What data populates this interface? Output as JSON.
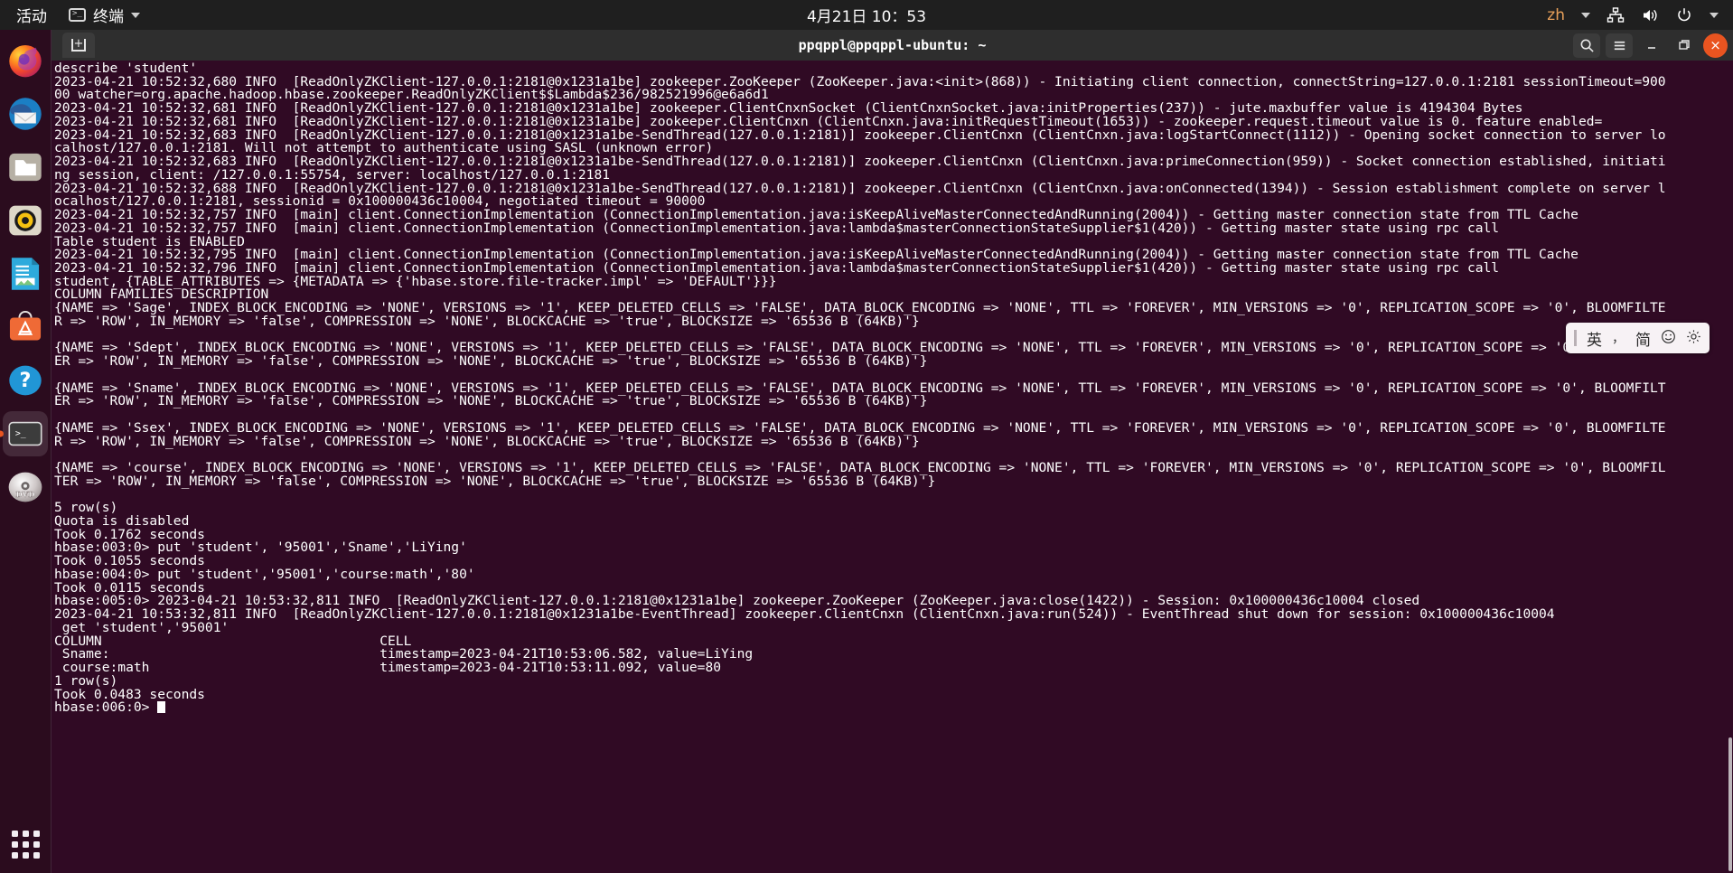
{
  "topbar": {
    "activities": "活动",
    "app_name": "终端",
    "clock": "4月21日 10：53",
    "language": "zh",
    "icons": [
      "network-icon",
      "volume-icon",
      "power-icon",
      "chevron-down-icon"
    ]
  },
  "dock": {
    "items": [
      {
        "name": "firefox",
        "active": false
      },
      {
        "name": "thunderbird",
        "active": false
      },
      {
        "name": "files",
        "active": false
      },
      {
        "name": "rhythmbox",
        "active": false
      },
      {
        "name": "libreoffice-writer",
        "active": false
      },
      {
        "name": "ubuntu-software",
        "active": false
      },
      {
        "name": "help",
        "active": false
      },
      {
        "name": "terminal",
        "active": true
      },
      {
        "name": "dvd-drive",
        "active": false
      }
    ],
    "show_applications_label": "Show Applications"
  },
  "window": {
    "title": "ppqppl@ppqppl-ubuntu: ~",
    "new_tab_label": "+",
    "search_label": "Search",
    "menu_label": "Menu",
    "minimize_label": "Minimize",
    "maximize_label": "Maximize",
    "close_label": "×"
  },
  "ime": {
    "mode": "英",
    "punctuation": "，",
    "script": "简",
    "emoji_label": "☺",
    "settings_label": "settings-icon"
  },
  "terminal": {
    "lines": [
      "describe 'student'",
      "2023-04-21 10:52:32,680 INFO  [ReadOnlyZKClient-127.0.0.1:2181@0x1231a1be] zookeeper.ZooKeeper (ZooKeeper.java:<init>(868)) - Initiating client connection, connectString=127.0.0.1:2181 sessionTimeout=900",
      "00 watcher=org.apache.hadoop.hbase.zookeeper.ReadOnlyZKClient$$Lambda$236/982521996@e6a6d1",
      "2023-04-21 10:52:32,681 INFO  [ReadOnlyZKClient-127.0.0.1:2181@0x1231a1be] zookeeper.ClientCnxnSocket (ClientCnxnSocket.java:initProperties(237)) - jute.maxbuffer value is 4194304 Bytes",
      "2023-04-21 10:52:32,681 INFO  [ReadOnlyZKClient-127.0.0.1:2181@0x1231a1be] zookeeper.ClientCnxn (ClientCnxn.java:initRequestTimeout(1653)) - zookeeper.request.timeout value is 0. feature enabled=",
      "2023-04-21 10:52:32,683 INFO  [ReadOnlyZKClient-127.0.0.1:2181@0x1231a1be-SendThread(127.0.0.1:2181)] zookeeper.ClientCnxn (ClientCnxn.java:logStartConnect(1112)) - Opening socket connection to server lo",
      "calhost/127.0.0.1:2181. Will not attempt to authenticate using SASL (unknown error)",
      "2023-04-21 10:52:32,683 INFO  [ReadOnlyZKClient-127.0.0.1:2181@0x1231a1be-SendThread(127.0.0.1:2181)] zookeeper.ClientCnxn (ClientCnxn.java:primeConnection(959)) - Socket connection established, initiati",
      "ng session, client: /127.0.0.1:55754, server: localhost/127.0.0.1:2181",
      "2023-04-21 10:52:32,688 INFO  [ReadOnlyZKClient-127.0.0.1:2181@0x1231a1be-SendThread(127.0.0.1:2181)] zookeeper.ClientCnxn (ClientCnxn.java:onConnected(1394)) - Session establishment complete on server l",
      "ocalhost/127.0.0.1:2181, sessionid = 0x100000436c10004, negotiated timeout = 90000",
      "2023-04-21 10:52:32,757 INFO  [main] client.ConnectionImplementation (ConnectionImplementation.java:isKeepAliveMasterConnectedAndRunning(2004)) - Getting master connection state from TTL Cache",
      "2023-04-21 10:52:32,757 INFO  [main] client.ConnectionImplementation (ConnectionImplementation.java:lambda$masterConnectionStateSupplier$1(420)) - Getting master state using rpc call",
      "Table student is ENABLED",
      "2023-04-21 10:52:32,795 INFO  [main] client.ConnectionImplementation (ConnectionImplementation.java:isKeepAliveMasterConnectedAndRunning(2004)) - Getting master connection state from TTL Cache",
      "2023-04-21 10:52:32,796 INFO  [main] client.ConnectionImplementation (ConnectionImplementation.java:lambda$masterConnectionStateSupplier$1(420)) - Getting master state using rpc call",
      "student, {TABLE_ATTRIBUTES => {METADATA => {'hbase.store.file-tracker.impl' => 'DEFAULT'}}}",
      "COLUMN FAMILIES DESCRIPTION",
      "{NAME => 'Sage', INDEX_BLOCK_ENCODING => 'NONE', VERSIONS => '1', KEEP_DELETED_CELLS => 'FALSE', DATA_BLOCK_ENCODING => 'NONE', TTL => 'FOREVER', MIN_VERSIONS => '0', REPLICATION_SCOPE => '0', BLOOMFILTE",
      "R => 'ROW', IN_MEMORY => 'false', COMPRESSION => 'NONE', BLOCKCACHE => 'true', BLOCKSIZE => '65536 B (64KB)'}",
      "",
      "{NAME => 'Sdept', INDEX_BLOCK_ENCODING => 'NONE', VERSIONS => '1', KEEP_DELETED_CELLS => 'FALSE', DATA_BLOCK_ENCODING => 'NONE', TTL => 'FOREVER', MIN_VERSIONS => '0', REPLICATION_SCOPE => '0', BLOOMFILT",
      "ER => 'ROW', IN_MEMORY => 'false', COMPRESSION => 'NONE', BLOCKCACHE => 'true', BLOCKSIZE => '65536 B (64KB)'}",
      "",
      "{NAME => 'Sname', INDEX_BLOCK_ENCODING => 'NONE', VERSIONS => '1', KEEP_DELETED_CELLS => 'FALSE', DATA_BLOCK_ENCODING => 'NONE', TTL => 'FOREVER', MIN_VERSIONS => '0', REPLICATION_SCOPE => '0', BLOOMFILT",
      "ER => 'ROW', IN_MEMORY => 'false', COMPRESSION => 'NONE', BLOCKCACHE => 'true', BLOCKSIZE => '65536 B (64KB)'}",
      "",
      "{NAME => 'Ssex', INDEX_BLOCK_ENCODING => 'NONE', VERSIONS => '1', KEEP_DELETED_CELLS => 'FALSE', DATA_BLOCK_ENCODING => 'NONE', TTL => 'FOREVER', MIN_VERSIONS => '0', REPLICATION_SCOPE => '0', BLOOMFILTE",
      "R => 'ROW', IN_MEMORY => 'false', COMPRESSION => 'NONE', BLOCKCACHE => 'true', BLOCKSIZE => '65536 B (64KB)'}",
      "",
      "{NAME => 'course', INDEX_BLOCK_ENCODING => 'NONE', VERSIONS => '1', KEEP_DELETED_CELLS => 'FALSE', DATA_BLOCK_ENCODING => 'NONE', TTL => 'FOREVER', MIN_VERSIONS => '0', REPLICATION_SCOPE => '0', BLOOMFIL",
      "TER => 'ROW', IN_MEMORY => 'false', COMPRESSION => 'NONE', BLOCKCACHE => 'true', BLOCKSIZE => '65536 B (64KB)'}",
      "",
      "5 row(s)",
      "Quota is disabled",
      "Took 0.1762 seconds",
      "hbase:003:0> put 'student', '95001','Sname','LiYing'",
      "Took 0.1055 seconds",
      "hbase:004:0> put 'student','95001','course:math','80'",
      "Took 0.0115 seconds",
      "hbase:005:0> 2023-04-21 10:53:32,811 INFO  [ReadOnlyZKClient-127.0.0.1:2181@0x1231a1be] zookeeper.ZooKeeper (ZooKeeper.java:close(1422)) - Session: 0x100000436c10004 closed",
      "2023-04-21 10:53:32,811 INFO  [ReadOnlyZKClient-127.0.0.1:2181@0x1231a1be-EventThread] zookeeper.ClientCnxn (ClientCnxn.java:run(524)) - EventThread shut down for session: 0x100000436c10004",
      " get 'student','95001'",
      "COLUMN                                   CELL",
      " Sname:                                  timestamp=2023-04-21T10:53:06.582, value=LiYing",
      " course:math                             timestamp=2023-04-21T10:53:11.092, value=80",
      "1 row(s)",
      "Took 0.0483 seconds"
    ],
    "prompt": "hbase:006:0> "
  },
  "colors": {
    "terminal_bg": "#300a24",
    "terminal_fg": "#ffffff",
    "accent": "#e95420",
    "titlebar_bg": "#2e2e2e",
    "topbar_bg": "#1f1f1f",
    "dock_bg": "#2b0c1e"
  }
}
